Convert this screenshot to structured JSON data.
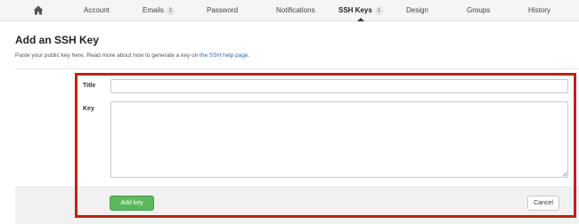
{
  "nav": {
    "home_icon": "home-icon",
    "items": [
      {
        "label": "Account"
      },
      {
        "label": "Emails",
        "badge": "1"
      },
      {
        "label": "Password"
      },
      {
        "label": "Notifications"
      },
      {
        "label": "SSH Keys",
        "badge": "1",
        "active": true
      },
      {
        "label": "Design"
      },
      {
        "label": "Groups"
      },
      {
        "label": "History"
      }
    ]
  },
  "page": {
    "title": "Add an SSH Key",
    "description_prefix": "Paste your public key here. Read more about how to generate a key on ",
    "description_link": "the SSH help page",
    "description_suffix": "."
  },
  "form": {
    "title_label": "Title",
    "title_value": "",
    "key_label": "Key",
    "key_value": "",
    "add_button": "Add key",
    "cancel_button": "Cancel"
  },
  "colors": {
    "highlight": "#c0201a",
    "add_button": "#5cb85c",
    "link": "#2a6db0"
  }
}
